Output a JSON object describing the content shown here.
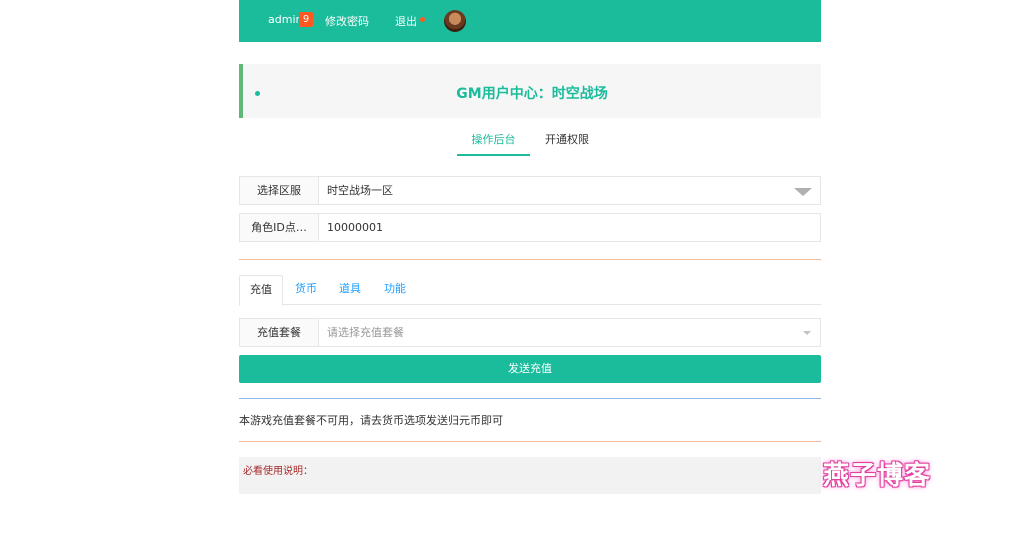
{
  "header": {
    "username": "admin",
    "badge_count": "9",
    "change_password": "修改密码",
    "logout": "退出"
  },
  "title": "GM用户中心：时空战场",
  "main_tabs": [
    "操作后台",
    "开通权限"
  ],
  "form": {
    "server_label": "选择区服",
    "server_value": "时空战场一区",
    "role_label": "角色ID点…",
    "role_value": "10000001"
  },
  "sub_tabs": [
    "充值",
    "货币",
    "道具",
    "功能"
  ],
  "recharge": {
    "label": "充值套餐",
    "placeholder": "请选择充值套餐",
    "button": "发送充值"
  },
  "notice": "本游戏充值套餐不可用，请去货币选项发送归元币即可",
  "guide_title": "必看使用说明：",
  "watermark": "燕子博客",
  "colors": {
    "primary": "#1abc9c",
    "badge": "#ff5722",
    "accent_border": "#5fb878",
    "link": "#1e9fff"
  }
}
